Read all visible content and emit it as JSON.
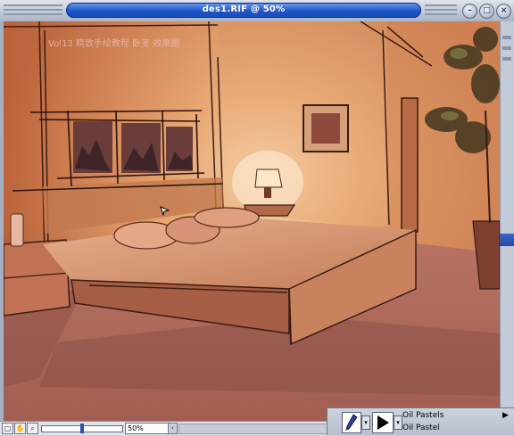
{
  "window": {
    "title": "des1.RIF @ 50%",
    "controls": {
      "minimize": "–",
      "maximize": "□",
      "close": "×"
    }
  },
  "canvas": {
    "overlay_text": "Vol13 精致手绘教程  卧室  效果图",
    "cursor_icon": "arrow-cursor-icon"
  },
  "statusbar": {
    "zoom_value": "50%",
    "zoom_level": 0.5,
    "icons": [
      "page-icon",
      "grabber-icon",
      "zoom-icon"
    ]
  },
  "brush_selector": {
    "category": "Oil Pastels",
    "variant": "Oil Pastel",
    "menu_arrow": "▶"
  },
  "colors": {
    "title_bar": "#1f55c8",
    "wall": "#c8703f",
    "floor": "#b87463"
  }
}
